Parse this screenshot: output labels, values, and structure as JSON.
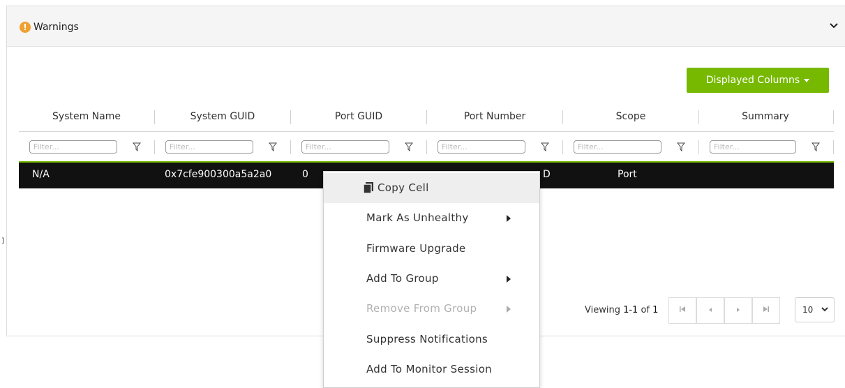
{
  "panel": {
    "title": "Warnings",
    "left_marker": "]"
  },
  "toolbar": {
    "displayed_columns_label": "Displayed Columns"
  },
  "table": {
    "columns": [
      "System Name",
      "System GUID",
      "Port GUID",
      "Port Number",
      "Scope",
      "Summary"
    ],
    "filter_placeholder": "Filter...",
    "rows": [
      {
        "system_name": "N/A",
        "system_guid": "0x7cfe900300a5a2a0",
        "port_guid": "0",
        "port_number": "D",
        "scope": "Port",
        "summary": ""
      }
    ]
  },
  "pagination": {
    "viewing_prefix": "Viewing ",
    "viewing_range": "1-1",
    "viewing_of": " of ",
    "viewing_total": "1",
    "page_size": "10"
  },
  "context_menu": {
    "items": [
      {
        "label": "Copy Cell",
        "icon": "copy-icon",
        "state": "hover"
      },
      {
        "label": "Mark As Unhealthy",
        "submenu": true,
        "state": "enabled"
      },
      {
        "label": "Firmware Upgrade",
        "state": "enabled"
      },
      {
        "label": "Add To Group",
        "submenu": true,
        "state": "enabled"
      },
      {
        "label": "Remove From Group",
        "submenu": true,
        "state": "disabled"
      },
      {
        "label": "Suppress Notifications",
        "state": "enabled"
      },
      {
        "label": "Add To Monitor Session",
        "state": "enabled"
      }
    ]
  },
  "colors": {
    "accent": "#76b900",
    "warning": "#f0a030",
    "selected_row": "#111111"
  }
}
